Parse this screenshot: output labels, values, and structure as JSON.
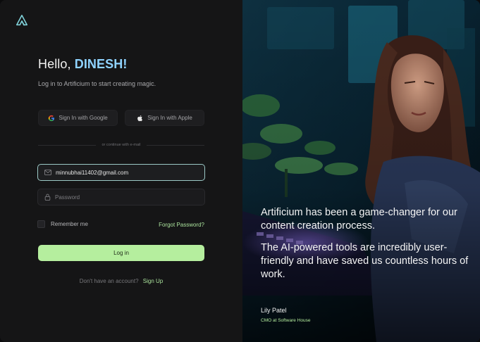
{
  "greeting": {
    "prefix": "Hello,",
    "name": "DINESH!"
  },
  "subtitle": "Log in to Artificium to start creating magic.",
  "social": {
    "google_label": "Sign In with Google",
    "apple_label": "Sign In with Apple"
  },
  "divider_text": "or continue with e-mail",
  "form": {
    "email_value": "minnubhai11402@gmail.com",
    "password_placeholder": "Password",
    "remember_label": "Remember me",
    "forgot_label": "Forgot Password?",
    "login_label": "Log in"
  },
  "signup": {
    "prompt": "Don't have an account?",
    "link": "Sign Up"
  },
  "testimonial": {
    "paragraph1": "Artificium has been a game-changer for our content creation process.",
    "paragraph2": "The AI-powered tools are incredibly user-friendly and have saved us countless hours of work.",
    "author": "Lily Patel",
    "role": "CMO at Software House"
  },
  "colors": {
    "accent_green": "#b5ee9e",
    "accent_blue": "#8fd3ff",
    "background": "#151516"
  },
  "icons": [
    "artificium-logo-icon",
    "google-icon",
    "apple-icon",
    "mail-icon",
    "lock-icon"
  ]
}
